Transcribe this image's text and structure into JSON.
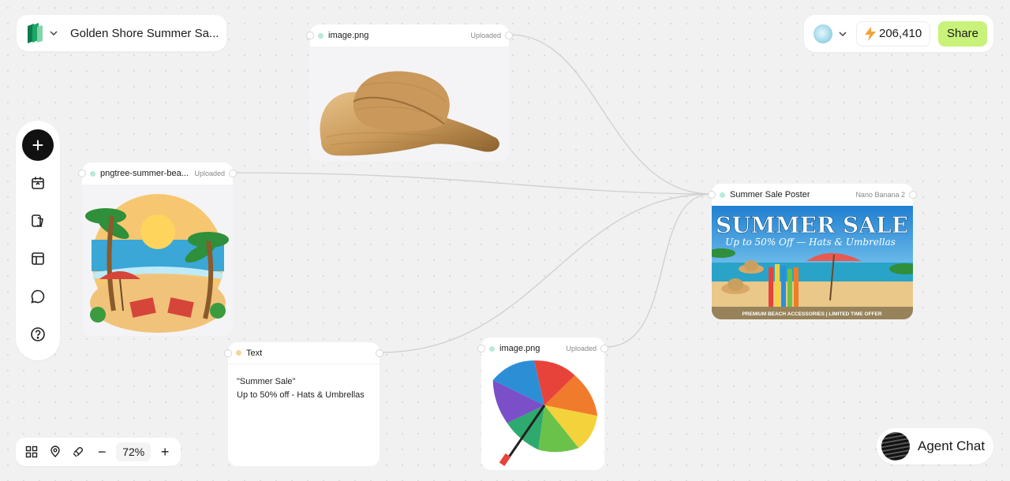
{
  "project": {
    "title": "Golden Shore Summer Sa...",
    "logo": "layers-logo-icon"
  },
  "topbar": {
    "credits": "206,410",
    "share_label": "Share",
    "accent": "#c8f27a"
  },
  "left_tools": [
    "add-icon",
    "calendar-icon",
    "assets-icon",
    "layout-icon",
    "chat-bubble-icon",
    "help-icon"
  ],
  "zoom": {
    "value": "72%",
    "minus": "−",
    "plus": "+"
  },
  "agent_chat": {
    "label": "Agent Chat"
  },
  "nodes": {
    "hat": {
      "title": "image.png",
      "tag": "Uploaded"
    },
    "beach": {
      "title": "pngtree-summer-bea...",
      "tag": "Uploaded"
    },
    "text": {
      "title": "Text",
      "line1": "\"Summer Sale\"",
      "line2": "Up to 50% off - Hats & Umbrellas"
    },
    "umbrella": {
      "title": "image.png",
      "tag": "Uploaded"
    },
    "poster": {
      "title": "Summer Sale Poster",
      "tag": "Nano Banana 2",
      "headline": "SUMMER SALE",
      "subhead": "Up to 50% Off — Hats & Umbrellas",
      "footer": "PREMIUM BEACH ACCESSORIES | LIMITED TIME OFFER"
    }
  }
}
